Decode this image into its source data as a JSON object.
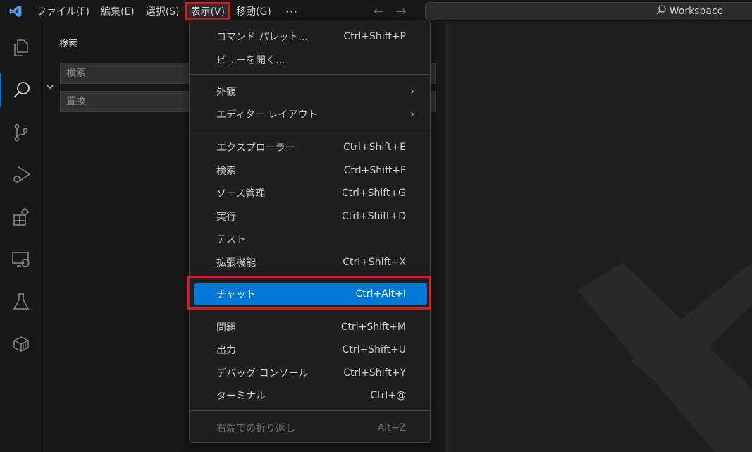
{
  "menubar": {
    "items": [
      {
        "label": "ファイル(F)"
      },
      {
        "label": "編集(E)"
      },
      {
        "label": "選択(S)"
      },
      {
        "label": "表示(V)"
      },
      {
        "label": "移動(G)"
      }
    ],
    "more": "···"
  },
  "command_center": {
    "text": "Workspace"
  },
  "sidebar": {
    "title": "検索",
    "search_placeholder": "検索",
    "replace_placeholder": "置換"
  },
  "view_menu": {
    "groups": [
      [
        {
          "label": "コマンド パレット...",
          "shortcut": "Ctrl+Shift+P"
        },
        {
          "label": "ビューを開く...",
          "shortcut": ""
        }
      ],
      [
        {
          "label": "外観",
          "submenu": "›"
        },
        {
          "label": "エディター レイアウト",
          "submenu": "›"
        }
      ],
      [
        {
          "label": "エクスプローラー",
          "shortcut": "Ctrl+Shift+E"
        },
        {
          "label": "検索",
          "shortcut": "Ctrl+Shift+F"
        },
        {
          "label": "ソース管理",
          "shortcut": "Ctrl+Shift+G"
        },
        {
          "label": "実行",
          "shortcut": "Ctrl+Shift+D"
        },
        {
          "label": "テスト",
          "shortcut": ""
        },
        {
          "label": "拡張機能",
          "shortcut": "Ctrl+Shift+X"
        }
      ],
      [
        {
          "label": "チャット",
          "shortcut": "Ctrl+Alt+I",
          "highlighted": true
        }
      ],
      [
        {
          "label": "問題",
          "shortcut": "Ctrl+Shift+M"
        },
        {
          "label": "出力",
          "shortcut": "Ctrl+Shift+U"
        },
        {
          "label": "デバッグ コンソール",
          "shortcut": "Ctrl+Shift+Y"
        },
        {
          "label": "ターミナル",
          "shortcut": "Ctrl+@"
        }
      ],
      [
        {
          "label": "右端での折り返し",
          "shortcut": "Alt+Z",
          "disabled": true
        }
      ]
    ]
  },
  "colors": {
    "accent": "#0078d4",
    "annotation_red": "#e0191c",
    "background": "#1f1f1f",
    "chrome": "#181818"
  }
}
